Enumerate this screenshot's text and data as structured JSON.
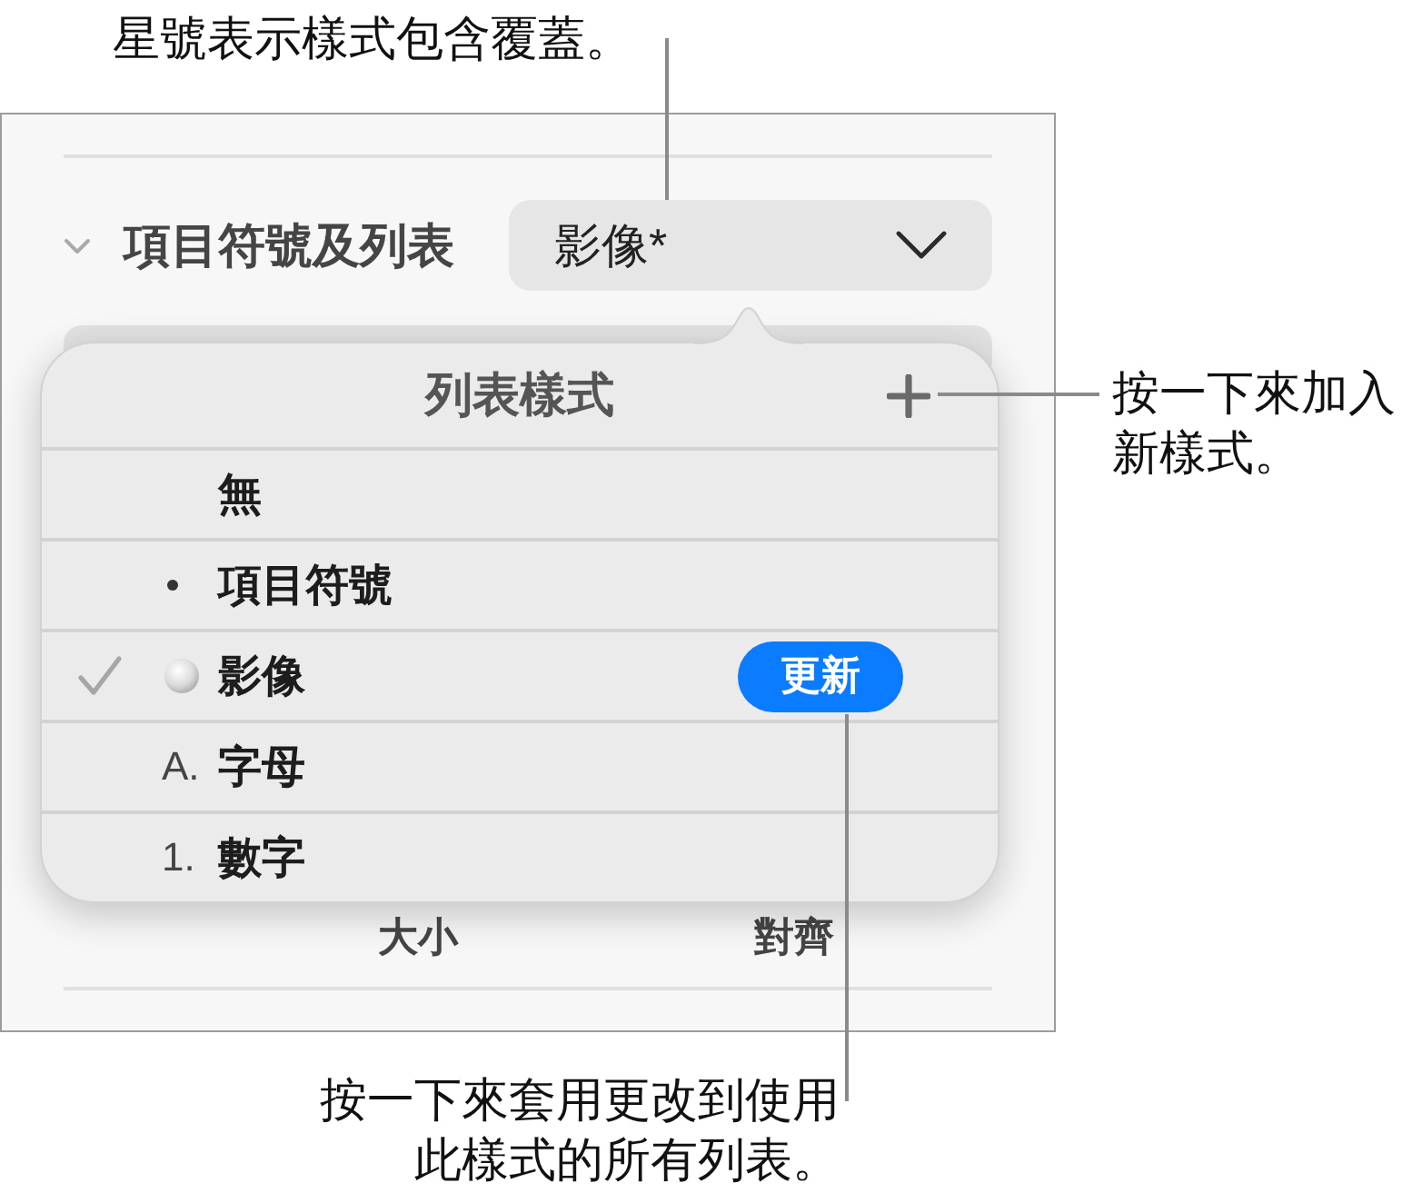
{
  "callout_top": {
    "text": "星號表示樣式包含覆蓋。"
  },
  "panel": {
    "section": {
      "title": "項目符號及列表",
      "expanded": true,
      "style_menu": {
        "value": "影像*"
      }
    },
    "labels": [
      "大小",
      "對齊"
    ]
  },
  "popover": {
    "title": "列表樣式",
    "items": [
      {
        "kind": "none",
        "label": "無",
        "selected": false
      },
      {
        "kind": "bullet",
        "label": "項目符號",
        "selected": false
      },
      {
        "kind": "image",
        "label": "影像",
        "selected": true,
        "button": "更新"
      },
      {
        "kind": "letter",
        "marker": "A.",
        "label": "字母",
        "selected": false
      },
      {
        "kind": "number",
        "marker": "1.",
        "label": "數字",
        "selected": false
      }
    ]
  },
  "callout_add": {
    "text": "按一下來加入新樣式。"
  },
  "callout_update": {
    "text": "按一下來套用更改到使用此樣式的所有列表。"
  }
}
